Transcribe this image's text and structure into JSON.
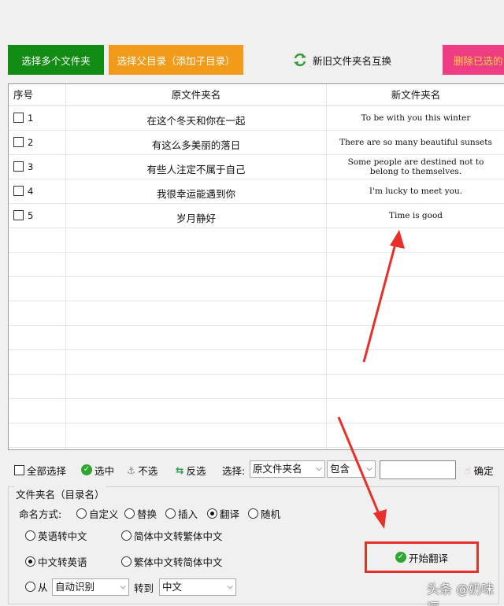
{
  "toolbar_top": {
    "select_multiple": "选择多个文件夹",
    "select_parent": "选择父目录（添加子目录）",
    "swap_names": "新旧文件夹名互换",
    "delete_selected": "删除已选的"
  },
  "table": {
    "headers": {
      "index": "序号",
      "original": "原文件夹名",
      "new": "新文件夹名"
    },
    "rows": [
      {
        "index": "1",
        "original": "在这个冬天和你在一起",
        "new": "To be with you this winter"
      },
      {
        "index": "2",
        "original": "有这么多美丽的落日",
        "new": "There are so many beautiful sunsets"
      },
      {
        "index": "3",
        "original": "有些人注定不属于自己",
        "new": "Some people are destined not to belong to themselves."
      },
      {
        "index": "4",
        "original": "我很幸运能遇到你",
        "new": "I'm lucky to meet you."
      },
      {
        "index": "5",
        "original": "岁月静好",
        "new": "Time is good"
      }
    ]
  },
  "selection_bar": {
    "select_all": "全部选择",
    "select": "选中",
    "deselect": "不选",
    "invert": "反选",
    "choose_label": "选择:",
    "field_value": "原文件夹名",
    "match_value": "包含",
    "filter_value": "",
    "confirm": "确定"
  },
  "rename": {
    "group_title": "文件夹名（目录名）",
    "mode_label": "命名方式:",
    "modes": {
      "custom": "自定义",
      "replace": "替换",
      "insert": "插入",
      "translate": "翻译",
      "random": "随机"
    },
    "selected_mode": "翻译",
    "options": {
      "en_to_zh": "英语转中文",
      "simp_to_trad": "简体中文转繁体中文",
      "zh_to_en": "中文转英语",
      "trad_to_simp": "繁体中文转简体中文",
      "from": "从",
      "from_value": "自动识别",
      "to": "转到",
      "to_value": "中文"
    },
    "selected_option": "中文转英语",
    "start_button": "开始翻译"
  },
  "watermark": "头条 @奶味逗",
  "colors": {
    "green": "#138c16",
    "orange": "#f29b1a",
    "pink": "#ee3d83",
    "annotation_red": "#e8302b"
  }
}
